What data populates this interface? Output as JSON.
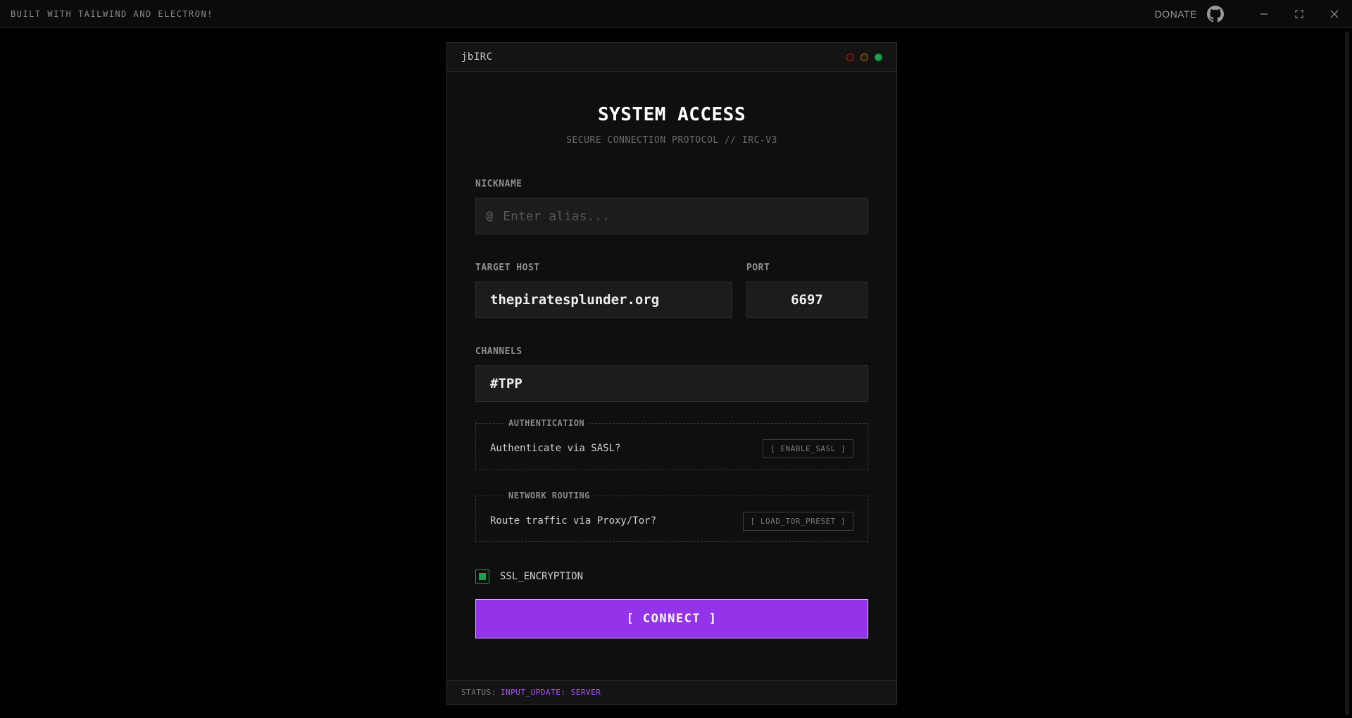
{
  "topbar": {
    "brand": "BUILT WITH TAILWIND AND ELECTRON!",
    "donate": "DONATE",
    "icons": [
      "github-icon",
      "minimize-icon",
      "maximize-icon",
      "close-icon"
    ]
  },
  "window": {
    "title": "jbIRC",
    "heading": "SYSTEM ACCESS",
    "subheading": "SECURE CONNECTION PROTOCOL // IRC-V3"
  },
  "form": {
    "nickname": {
      "label": "NICKNAME",
      "prefix": "@",
      "placeholder": "Enter alias...",
      "value": ""
    },
    "host": {
      "label": "TARGET HOST",
      "value": "thepiratesplunder.org"
    },
    "port": {
      "label": "PORT",
      "value": "6697"
    },
    "channels": {
      "label": "CHANNELS",
      "value": "#TPP"
    },
    "auth": {
      "legend": "AUTHENTICATION",
      "text": "Authenticate via SASL?",
      "button": "[ ENABLE_SASL ]"
    },
    "routing": {
      "legend": "NETWORK ROUTING",
      "text": "Route traffic via Proxy/Tor?",
      "button": "[ LOAD_TOR_PRESET ]"
    },
    "ssl": {
      "label": "SSL_ENCRYPTION",
      "checked": true
    },
    "connect": "[ CONNECT ]"
  },
  "status": {
    "key": "STATUS:",
    "value": "INPUT_UPDATE: SERVER"
  },
  "colors": {
    "accent": "#9333ea",
    "ssl_green": "#16a34a",
    "status_value": "#a855f7"
  }
}
